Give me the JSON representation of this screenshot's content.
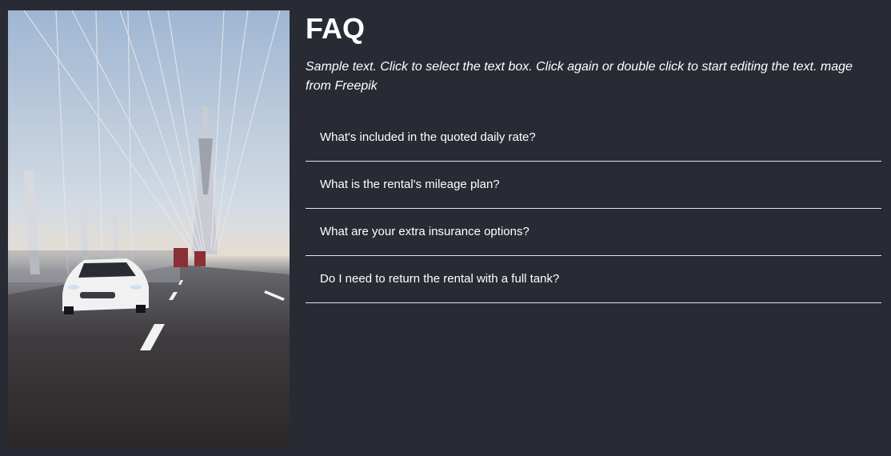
{
  "faq": {
    "title": "FAQ",
    "intro": "Sample text. Click to select the text box. Click again or double click to start editing the text. mage from Freepik",
    "items": [
      {
        "question": "What's included in the quoted daily rate?"
      },
      {
        "question": "What is the rental's mileage plan?"
      },
      {
        "question": "What are your extra insurance options?"
      },
      {
        "question": "Do I need to return the rental with a full tank?"
      }
    ]
  },
  "image": {
    "subject": "white sports car driving on a suspension bridge"
  },
  "colors": {
    "background": "#292b34",
    "text": "#ffffff",
    "divider": "#e4e4e4"
  }
}
